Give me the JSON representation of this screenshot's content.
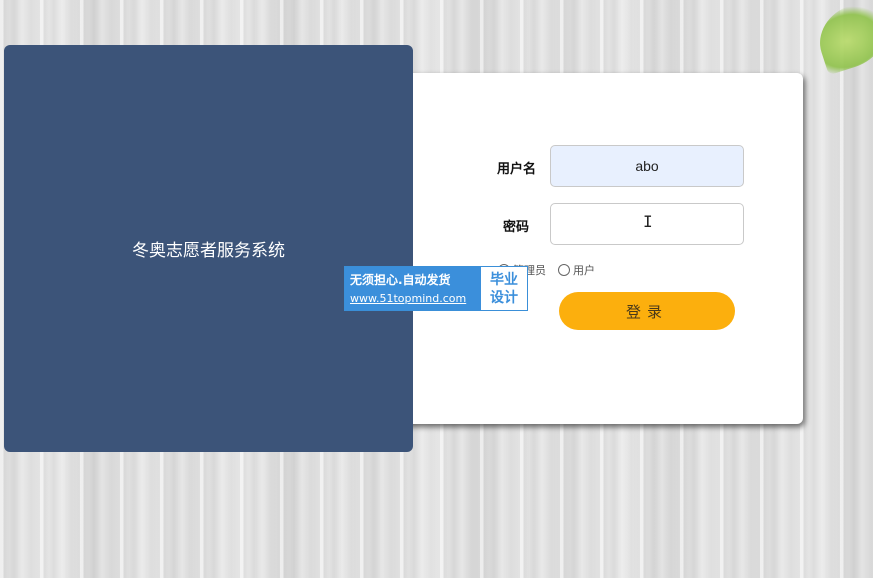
{
  "panel": {
    "title": "冬奥志愿者服务系统"
  },
  "form": {
    "username_label": "用户名",
    "username_value": "abo",
    "password_label": "密码",
    "password_value": "",
    "roles": [
      {
        "label": "管理员",
        "selected": false
      },
      {
        "label": "用户",
        "selected": false
      }
    ],
    "login_label": "登录"
  },
  "watermark": {
    "line1": "无须担心.自动发货",
    "line2": "www.51topmind.com",
    "badge_line1": "毕业",
    "badge_line2": "设计"
  },
  "colors": {
    "panel_bg": "#3c5479",
    "button_bg": "#fcaf0d",
    "username_field_bg": "#e8f0fe",
    "watermark_blue": "#3b8fdb"
  },
  "icons": {
    "text_cursor": "i-beam-cursor-icon",
    "leaf": "leaf-icon"
  }
}
